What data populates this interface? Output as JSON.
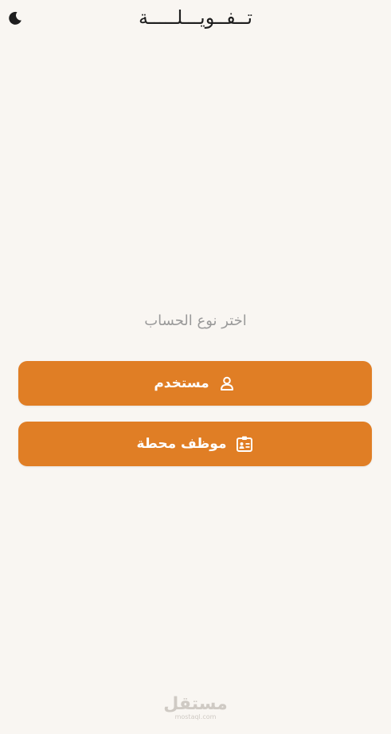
{
  "header": {
    "title": "تــفــويـــلـــــة",
    "theme_icon": "moon-icon"
  },
  "main": {
    "prompt": "اختر نوع الحساب",
    "options": [
      {
        "label": "مستخدم",
        "icon": "user-icon"
      },
      {
        "label": "موظف محطة",
        "icon": "id-badge-icon"
      }
    ]
  },
  "colors": {
    "background": "#f9f6f2",
    "accent": "#e07e25",
    "prompt_text": "#9a9a9a",
    "title_text": "#1e1e1e"
  },
  "watermark": {
    "brand": "مستقل",
    "domain": "mostaql.com"
  }
}
